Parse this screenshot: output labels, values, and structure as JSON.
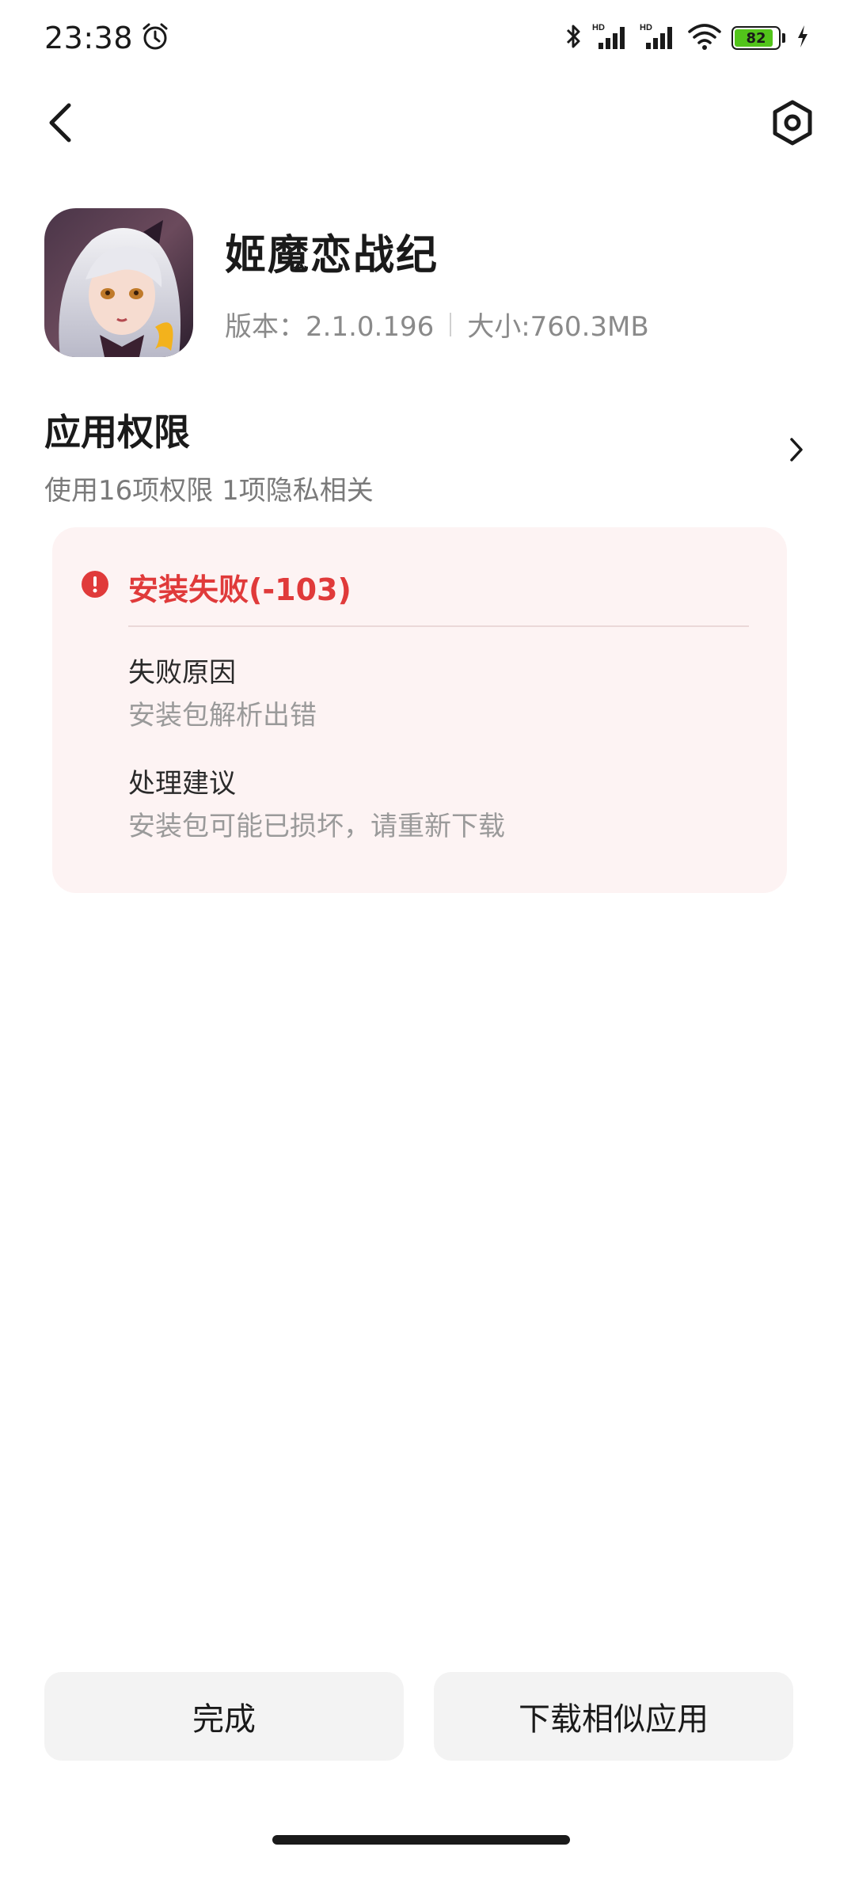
{
  "status_bar": {
    "time": "23:38",
    "battery_level": "82",
    "icons": [
      "alarm-icon",
      "bluetooth-icon",
      "signal-hd-icon",
      "signal-hd-icon",
      "wifi-icon",
      "battery-icon",
      "charging-icon"
    ]
  },
  "nav": {
    "back_icon": "chevron-left-icon",
    "settings_icon": "hexagon-settings-icon"
  },
  "app": {
    "name": "姬魔恋战纪",
    "version": "版本：2.1.0.196",
    "size": "大小:760.3MB"
  },
  "permissions": {
    "title": "应用权限",
    "summary": "使用16项权限 1项隐私相关"
  },
  "error": {
    "title": "安装失败(-103)",
    "reason_label": "失败原因",
    "reason_value": "安装包解析出错",
    "suggestion_label": "处理建议",
    "suggestion_value": "安装包可能已损坏，请重新下载",
    "color": "#e03a3a"
  },
  "buttons": {
    "done": "完成",
    "download_similar": "下载相似应用"
  },
  "colors": {
    "error_red": "#e03a3a",
    "card_bg": "#fdf3f3",
    "battery_green": "#52c41a"
  }
}
